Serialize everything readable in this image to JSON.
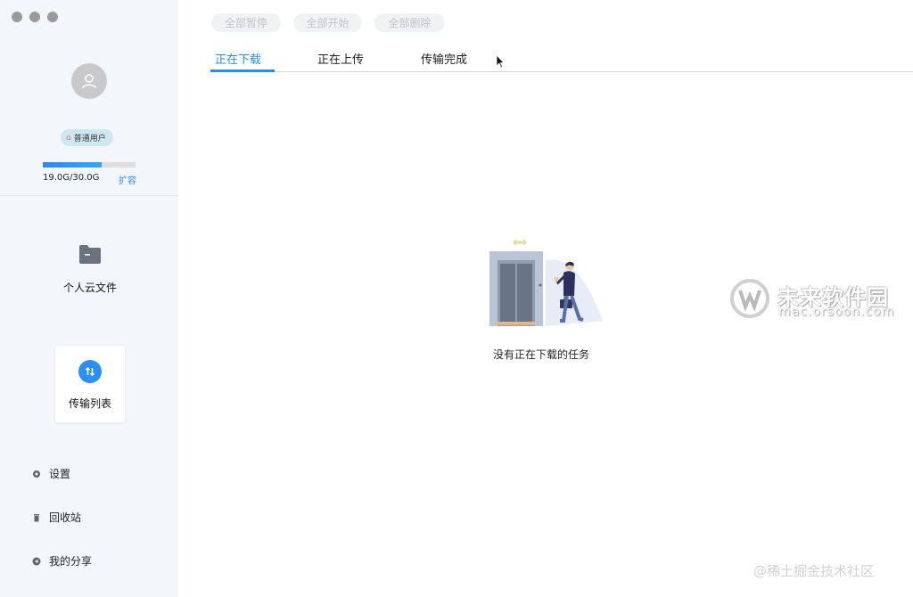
{
  "sidebar": {
    "user_badge": "普通用户",
    "storage_text": "19.0G/30.0G",
    "storage_used_fraction": 0.633,
    "expand_label": "扩容",
    "nav": [
      {
        "label": "个人云文件",
        "icon": "folder-icon"
      },
      {
        "label": "传输列表",
        "icon": "transfer-icon"
      }
    ],
    "links": [
      {
        "label": "设置",
        "icon": "gear-icon"
      },
      {
        "label": "回收站",
        "icon": "trash-icon"
      },
      {
        "label": "我的分享",
        "icon": "share-icon"
      }
    ]
  },
  "toolbar": {
    "pause_all": "全部暂停",
    "start_all": "全部开始",
    "delete_all": "全部删除"
  },
  "tabs": [
    {
      "label": "正在下载",
      "active": true
    },
    {
      "label": "正在上传",
      "active": false
    },
    {
      "label": "传输完成",
      "active": false
    }
  ],
  "empty_state": {
    "message": "没有正在下载的任务"
  },
  "watermarks": {
    "site_cn": "未来软件园",
    "site_url": "mac.orsoon.com",
    "footer": "@稀土掘金技术社区"
  },
  "colors": {
    "accent": "#2b8cf0",
    "sidebar_bg": "#f3f6fb",
    "disabled_btn_bg": "#f1f2f4",
    "disabled_btn_text": "#c0c3c8"
  }
}
